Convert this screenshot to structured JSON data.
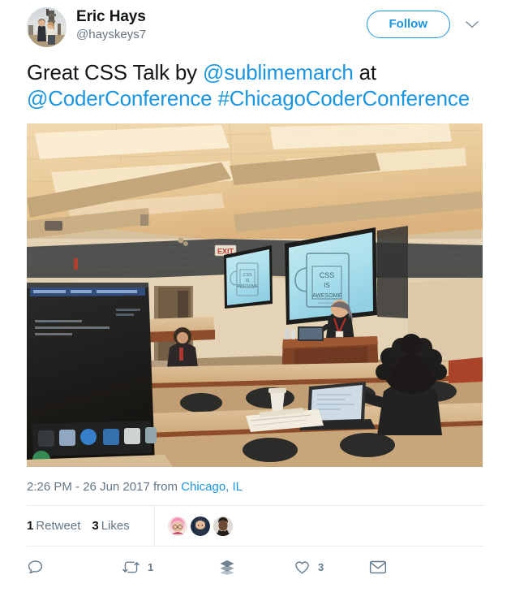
{
  "author": {
    "display_name": "Eric Hays",
    "handle": "@hayskeys7",
    "avatar_alt": "couple-outdoors-avatar"
  },
  "header": {
    "follow_label": "Follow",
    "caret_icon": "chevron-down-icon"
  },
  "tweet": {
    "text_parts": [
      {
        "type": "text",
        "value": "Great CSS Talk by "
      },
      {
        "type": "mention",
        "value": "@sublimemarch"
      },
      {
        "type": "text",
        "value": " at "
      },
      {
        "type": "mention",
        "value": "@CoderConference"
      },
      {
        "type": "text",
        "value": " "
      },
      {
        "type": "hashtag",
        "value": "#ChicagoCoderConference"
      }
    ],
    "plain_text": "Great CSS Talk by @sublimemarch at @CoderConference #ChicagoCoderConference",
    "segment_1": "Great CSS Talk by ",
    "segment_2": "@sublimemarch",
    "segment_3": " at ",
    "segment_4": "@CoderConference",
    "segment_5": " ",
    "segment_6": "#ChicagoCoderConference"
  },
  "photo": {
    "alt": "Conference room lecture hall with CSS IS AWESOME mug slide on two projection screens, speaker at podium, attendees at tiered desks, laptop in foreground",
    "slide_text_line1": "CSS",
    "slide_text_line2": "IS",
    "slide_text_line3": "AWESOME",
    "exit_sign": "EXIT"
  },
  "meta": {
    "time": "2:26 PM",
    "separator": " - ",
    "date": "26 Jun 2017",
    "from_label": " from ",
    "location": "Chicago, IL"
  },
  "stats": {
    "retweet_count": "1",
    "retweet_label": "Retweet",
    "like_count": "3",
    "like_label": "Likes",
    "likers": [
      {
        "name": "liker-avatar-1"
      },
      {
        "name": "liker-avatar-2"
      },
      {
        "name": "liker-avatar-3"
      }
    ]
  },
  "actions": {
    "reply": {
      "icon": "reply-icon",
      "count": ""
    },
    "retweet": {
      "icon": "retweet-icon",
      "count": "1"
    },
    "buffer": {
      "icon": "buffer-stack-icon",
      "count": ""
    },
    "like": {
      "icon": "heart-icon",
      "count": "3"
    },
    "message": {
      "icon": "envelope-icon",
      "count": ""
    }
  },
  "colors": {
    "link": "#1b95e0",
    "text": "#14171a",
    "muted": "#657786",
    "icon": "#667b8b",
    "divider": "#e6ecf0"
  }
}
